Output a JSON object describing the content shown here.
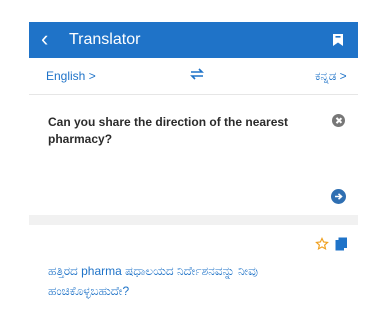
{
  "appbar": {
    "back_icon": "chevron-left-icon",
    "title": "Translator",
    "bookmark_icon": "bookmark-icon"
  },
  "languages": {
    "source": "English >",
    "swap_icon": "swap-icon",
    "target": "ಕನ್ನಡ >"
  },
  "input": {
    "text": "Can you share the direction of the nearest pharmacy?",
    "clear_icon": "clear-icon",
    "go_icon": "go-arrow-icon"
  },
  "result": {
    "star_icon": "star-outline-icon",
    "copy_icon": "copy-icon",
    "text": "ಹತ್ತಿರದ pharma ಷಧಾಲಯದ ನಿರ್ದೇಶನವನ್ನು ನೀವು ಹಂಚಿಕೊಳ್ಳಬಹುದೇ?"
  },
  "colors": {
    "accent": "#1f73c8",
    "star": "#f0a020"
  }
}
